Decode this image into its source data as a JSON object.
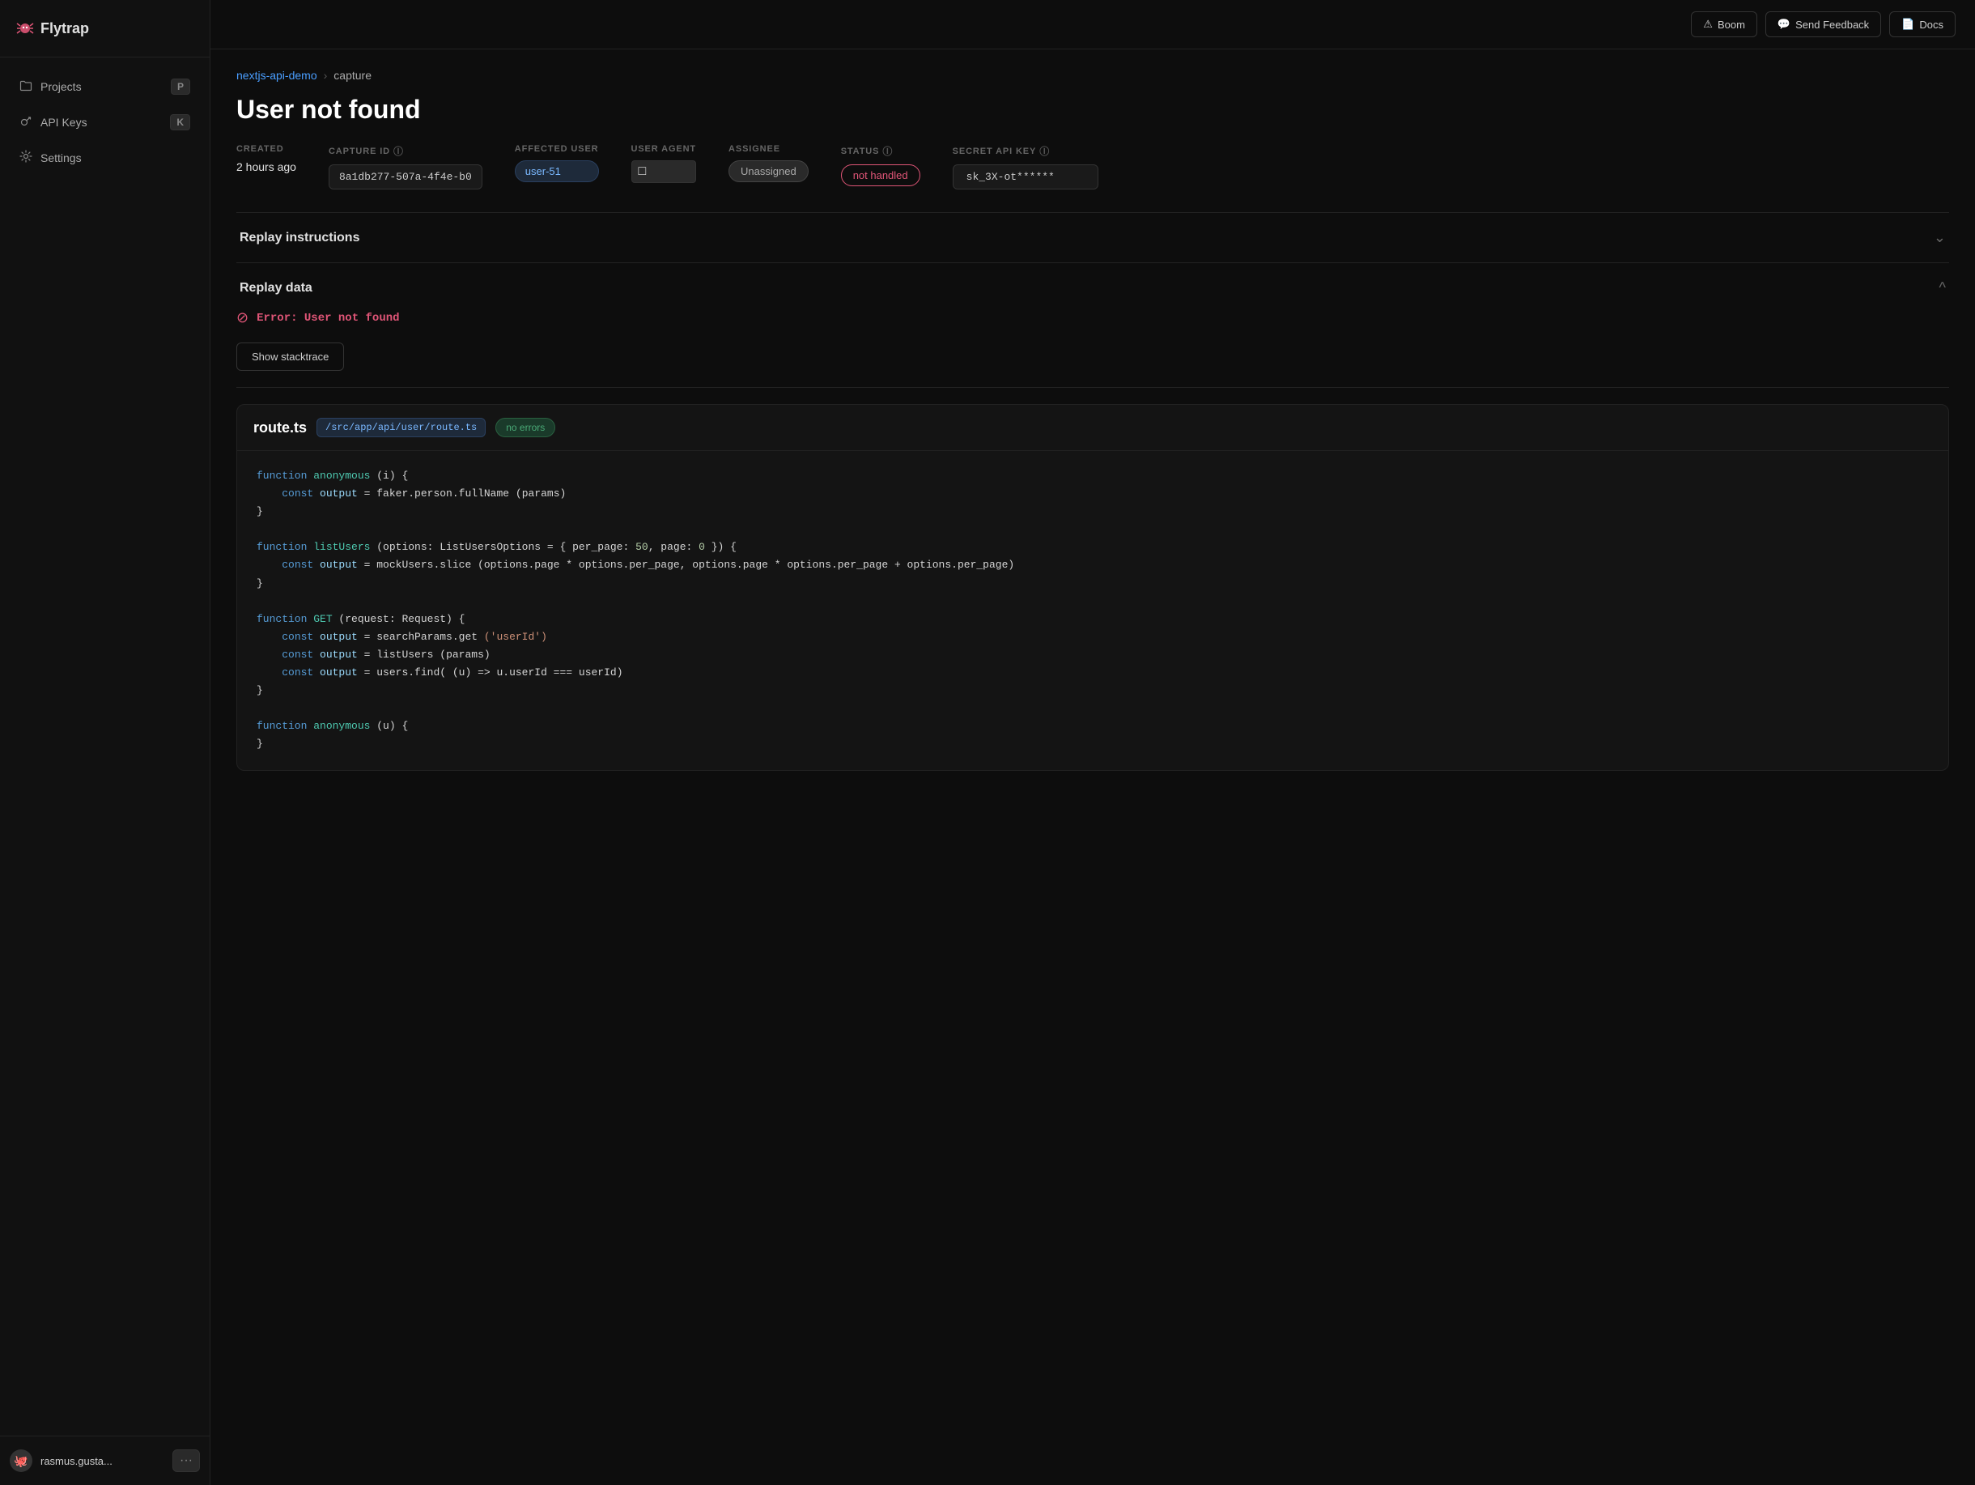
{
  "app": {
    "name": "Flytrap"
  },
  "sidebar": {
    "items": [
      {
        "id": "projects",
        "label": "Projects",
        "badge": "P",
        "icon": "folder-icon"
      },
      {
        "id": "api-keys",
        "label": "API Keys",
        "badge": "K",
        "icon": "key-icon"
      },
      {
        "id": "settings",
        "label": "Settings",
        "badge": "",
        "icon": "gear-icon"
      }
    ],
    "user": {
      "name": "rasmus.gusta...",
      "avatar": "🐙"
    },
    "more_btn": "···"
  },
  "topbar": {
    "boom_btn": "Boom",
    "feedback_btn": "Send Feedback",
    "docs_btn": "Docs"
  },
  "breadcrumb": {
    "link": "nextjs-api-demo",
    "separator": "›",
    "current": "capture"
  },
  "page": {
    "title": "User not found"
  },
  "meta": {
    "created_label": "CREATED",
    "created_value": "2 hours ago",
    "capture_id_label": "CAPTURE ID",
    "capture_id_value": "8a1db277-507a-4f4e-b0",
    "affected_user_label": "AFFECTED USER",
    "affected_user_value": "user-51",
    "user_agent_label": "USER AGENT",
    "user_agent_icon": "□",
    "assignee_label": "ASSIGNEE",
    "assignee_value": "Unassigned",
    "status_label": "STATUS",
    "status_value": "not handled",
    "secret_api_key_label": "SECRET API KEY",
    "secret_api_key_value": "sk_3X-ot******"
  },
  "replay_instructions": {
    "title": "Replay instructions",
    "expanded": false
  },
  "replay_data": {
    "title": "Replay data",
    "expanded": true,
    "error_text": "Error: User not found",
    "stacktrace_btn": "Show stacktrace"
  },
  "code_block": {
    "filename": "route.ts",
    "path": "/src/app/api/user/route.ts",
    "status_badge": "no errors",
    "lines": [
      {
        "content": "function anonymous (i) {",
        "tokens": [
          {
            "text": "function ",
            "class": "code-keyword"
          },
          {
            "text": "anonymous",
            "class": "code-fn-name"
          },
          {
            "text": " (i) {",
            "class": "code-plain"
          }
        ]
      },
      {
        "content": "  const output = faker.person.fullName (params)",
        "tokens": [
          {
            "text": "    ",
            "class": "code-plain"
          },
          {
            "text": "const ",
            "class": "code-keyword"
          },
          {
            "text": "output",
            "class": "code-var"
          },
          {
            "text": " = faker.person.fullName ",
            "class": "code-plain"
          },
          {
            "text": "(params)",
            "class": "code-plain"
          }
        ]
      },
      {
        "content": "}",
        "tokens": [
          {
            "text": "}",
            "class": "code-plain"
          }
        ]
      },
      {
        "content": "",
        "tokens": []
      },
      {
        "content": "function listUsers (options: ListUsersOptions = { per_page: 50, page: 0 }) {",
        "tokens": [
          {
            "text": "function ",
            "class": "code-keyword"
          },
          {
            "text": "listUsers",
            "class": "code-fn-name"
          },
          {
            "text": " (options: ListUsersOptions = { per_page: ",
            "class": "code-plain"
          },
          {
            "text": "50",
            "class": "code-number"
          },
          {
            "text": ", page: ",
            "class": "code-plain"
          },
          {
            "text": "0",
            "class": "code-number"
          },
          {
            "text": " }) {",
            "class": "code-plain"
          }
        ]
      },
      {
        "content": "  const output = mockUsers.slice(options.page * options.per_page, options.page * options.per_page + options.per_page)",
        "tokens": [
          {
            "text": "    ",
            "class": "code-plain"
          },
          {
            "text": "const ",
            "class": "code-keyword"
          },
          {
            "text": "output",
            "class": "code-var"
          },
          {
            "text": " = mockUsers.slice (options.page * options.per_page, options.page * options.per_page + options.per_page)",
            "class": "code-plain"
          }
        ]
      },
      {
        "content": "}",
        "tokens": [
          {
            "text": "}",
            "class": "code-plain"
          }
        ]
      },
      {
        "content": "",
        "tokens": []
      },
      {
        "content": "function GET (request: Request) {",
        "tokens": [
          {
            "text": "function ",
            "class": "code-keyword"
          },
          {
            "text": "GET",
            "class": "code-fn-name"
          },
          {
            "text": " (request: Request) {",
            "class": "code-plain"
          }
        ]
      },
      {
        "content": "  const output = searchParams.get ('userId')",
        "tokens": [
          {
            "text": "    ",
            "class": "code-plain"
          },
          {
            "text": "const ",
            "class": "code-keyword"
          },
          {
            "text": "output",
            "class": "code-var"
          },
          {
            "text": " = searchParams.get ",
            "class": "code-plain"
          },
          {
            "text": "('userId')",
            "class": "code-string"
          }
        ]
      },
      {
        "content": "  const output = listUsers (params)",
        "tokens": [
          {
            "text": "    ",
            "class": "code-plain"
          },
          {
            "text": "const ",
            "class": "code-keyword"
          },
          {
            "text": "output",
            "class": "code-var"
          },
          {
            "text": " = listUsers ",
            "class": "code-plain"
          },
          {
            "text": "(params)",
            "class": "code-plain"
          }
        ]
      },
      {
        "content": "  const output = users.find( (u) => u.userId === userId)",
        "tokens": [
          {
            "text": "    ",
            "class": "code-plain"
          },
          {
            "text": "const ",
            "class": "code-keyword"
          },
          {
            "text": "output",
            "class": "code-var"
          },
          {
            "text": " = users.find( (u) => u.userId === userId)",
            "class": "code-plain"
          }
        ]
      },
      {
        "content": "}",
        "tokens": [
          {
            "text": "}",
            "class": "code-plain"
          }
        ]
      },
      {
        "content": "",
        "tokens": []
      },
      {
        "content": "function anonymous (u) {",
        "tokens": [
          {
            "text": "function ",
            "class": "code-keyword"
          },
          {
            "text": "anonymous",
            "class": "code-fn-name"
          },
          {
            "text": " (u) {",
            "class": "code-plain"
          }
        ]
      },
      {
        "content": "}",
        "tokens": [
          {
            "text": "}",
            "class": "code-plain"
          }
        ]
      }
    ]
  }
}
